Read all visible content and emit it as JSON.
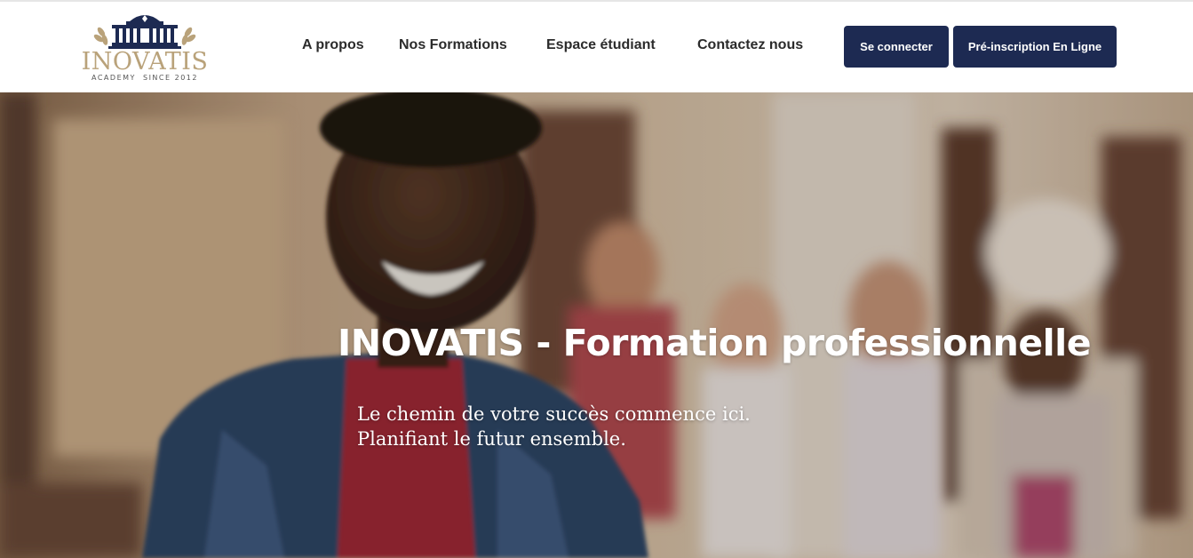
{
  "brand": {
    "name": "INOVATIS",
    "tagline": "ACADEMY  SINCE 2012",
    "navy": "#1d2a52",
    "gold": "#b9a27a",
    "icon": "classical-building-logo"
  },
  "nav": {
    "items": [
      {
        "label": "A propos"
      },
      {
        "label": "Nos Formations"
      },
      {
        "label": "Espace étudiant"
      },
      {
        "label": "Contactez nous"
      }
    ]
  },
  "buttons": {
    "login": "Se connecter",
    "preregister": "Pré-inscription En Ligne",
    "color": "#1d2a52"
  },
  "hero": {
    "title": "INOVATIS - Formation professionnelle",
    "subtitle_line1": "Le chemin de votre succès commence ici.",
    "subtitle_line2": "Planifiant le futur ensemble.",
    "image": "smiling-student-group-photo"
  }
}
